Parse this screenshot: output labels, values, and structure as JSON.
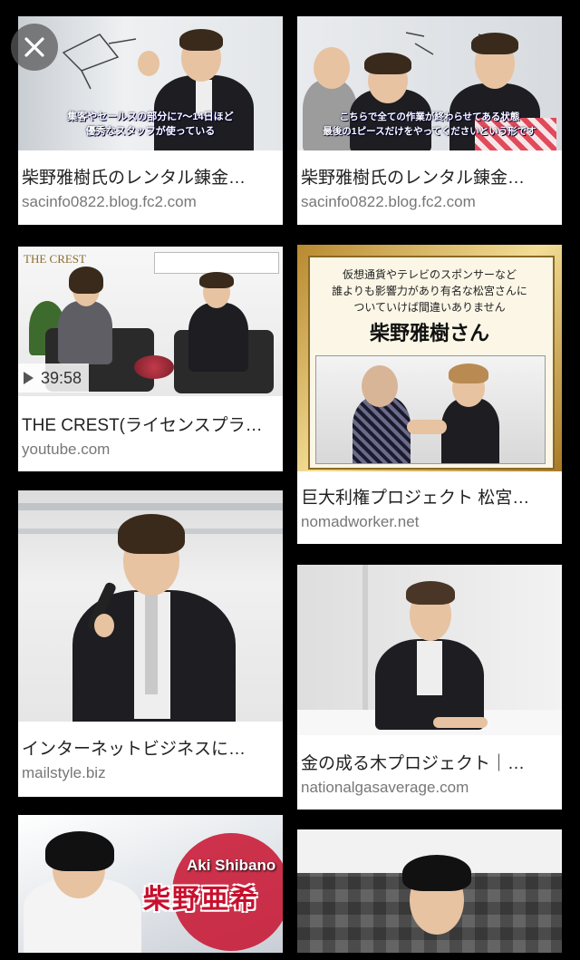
{
  "close": {
    "icon": "close-icon"
  },
  "results": {
    "left": [
      {
        "title": "柴野雅樹氏のレンタル錬金…",
        "source": "sacinfo0822.blog.fc2.com",
        "subtitle_1": "集客やセールスの部分に7〜14日ほど",
        "subtitle_2": "優秀なスタッフが使っている"
      },
      {
        "title": "THE CREST(ライセンスプラ…",
        "source": "youtube.com",
        "duration": "39:58",
        "logo": "THE CREST"
      },
      {
        "title": "インターネットビジネスに…",
        "source": "mailstyle.biz"
      },
      {
        "name_en": "Aki Shibano",
        "name_jp": "柴野亜希"
      }
    ],
    "right": [
      {
        "title": "柴野雅樹氏のレンタル錬金…",
        "source": "sacinfo0822.blog.fc2.com",
        "subtitle_1": "こちらで全ての作業が終わらせてある状態",
        "subtitle_2": "最後の1ピースだけをやってくださいという形です"
      },
      {
        "title": "巨大利権プロジェクト 松宮…",
        "source": "nomadworker.net",
        "panel_line_1": "仮想通貨やテレビのスポンサーなど",
        "panel_line_2": "誰よりも影響力があり有名な松宮さんに",
        "panel_line_3": "ついていけば間違いありません",
        "panel_name": "柴野雅樹さん"
      },
      {
        "title": "金の成る木プロジェクト｜…",
        "source": "nationalgasaverage.com"
      },
      {}
    ]
  }
}
